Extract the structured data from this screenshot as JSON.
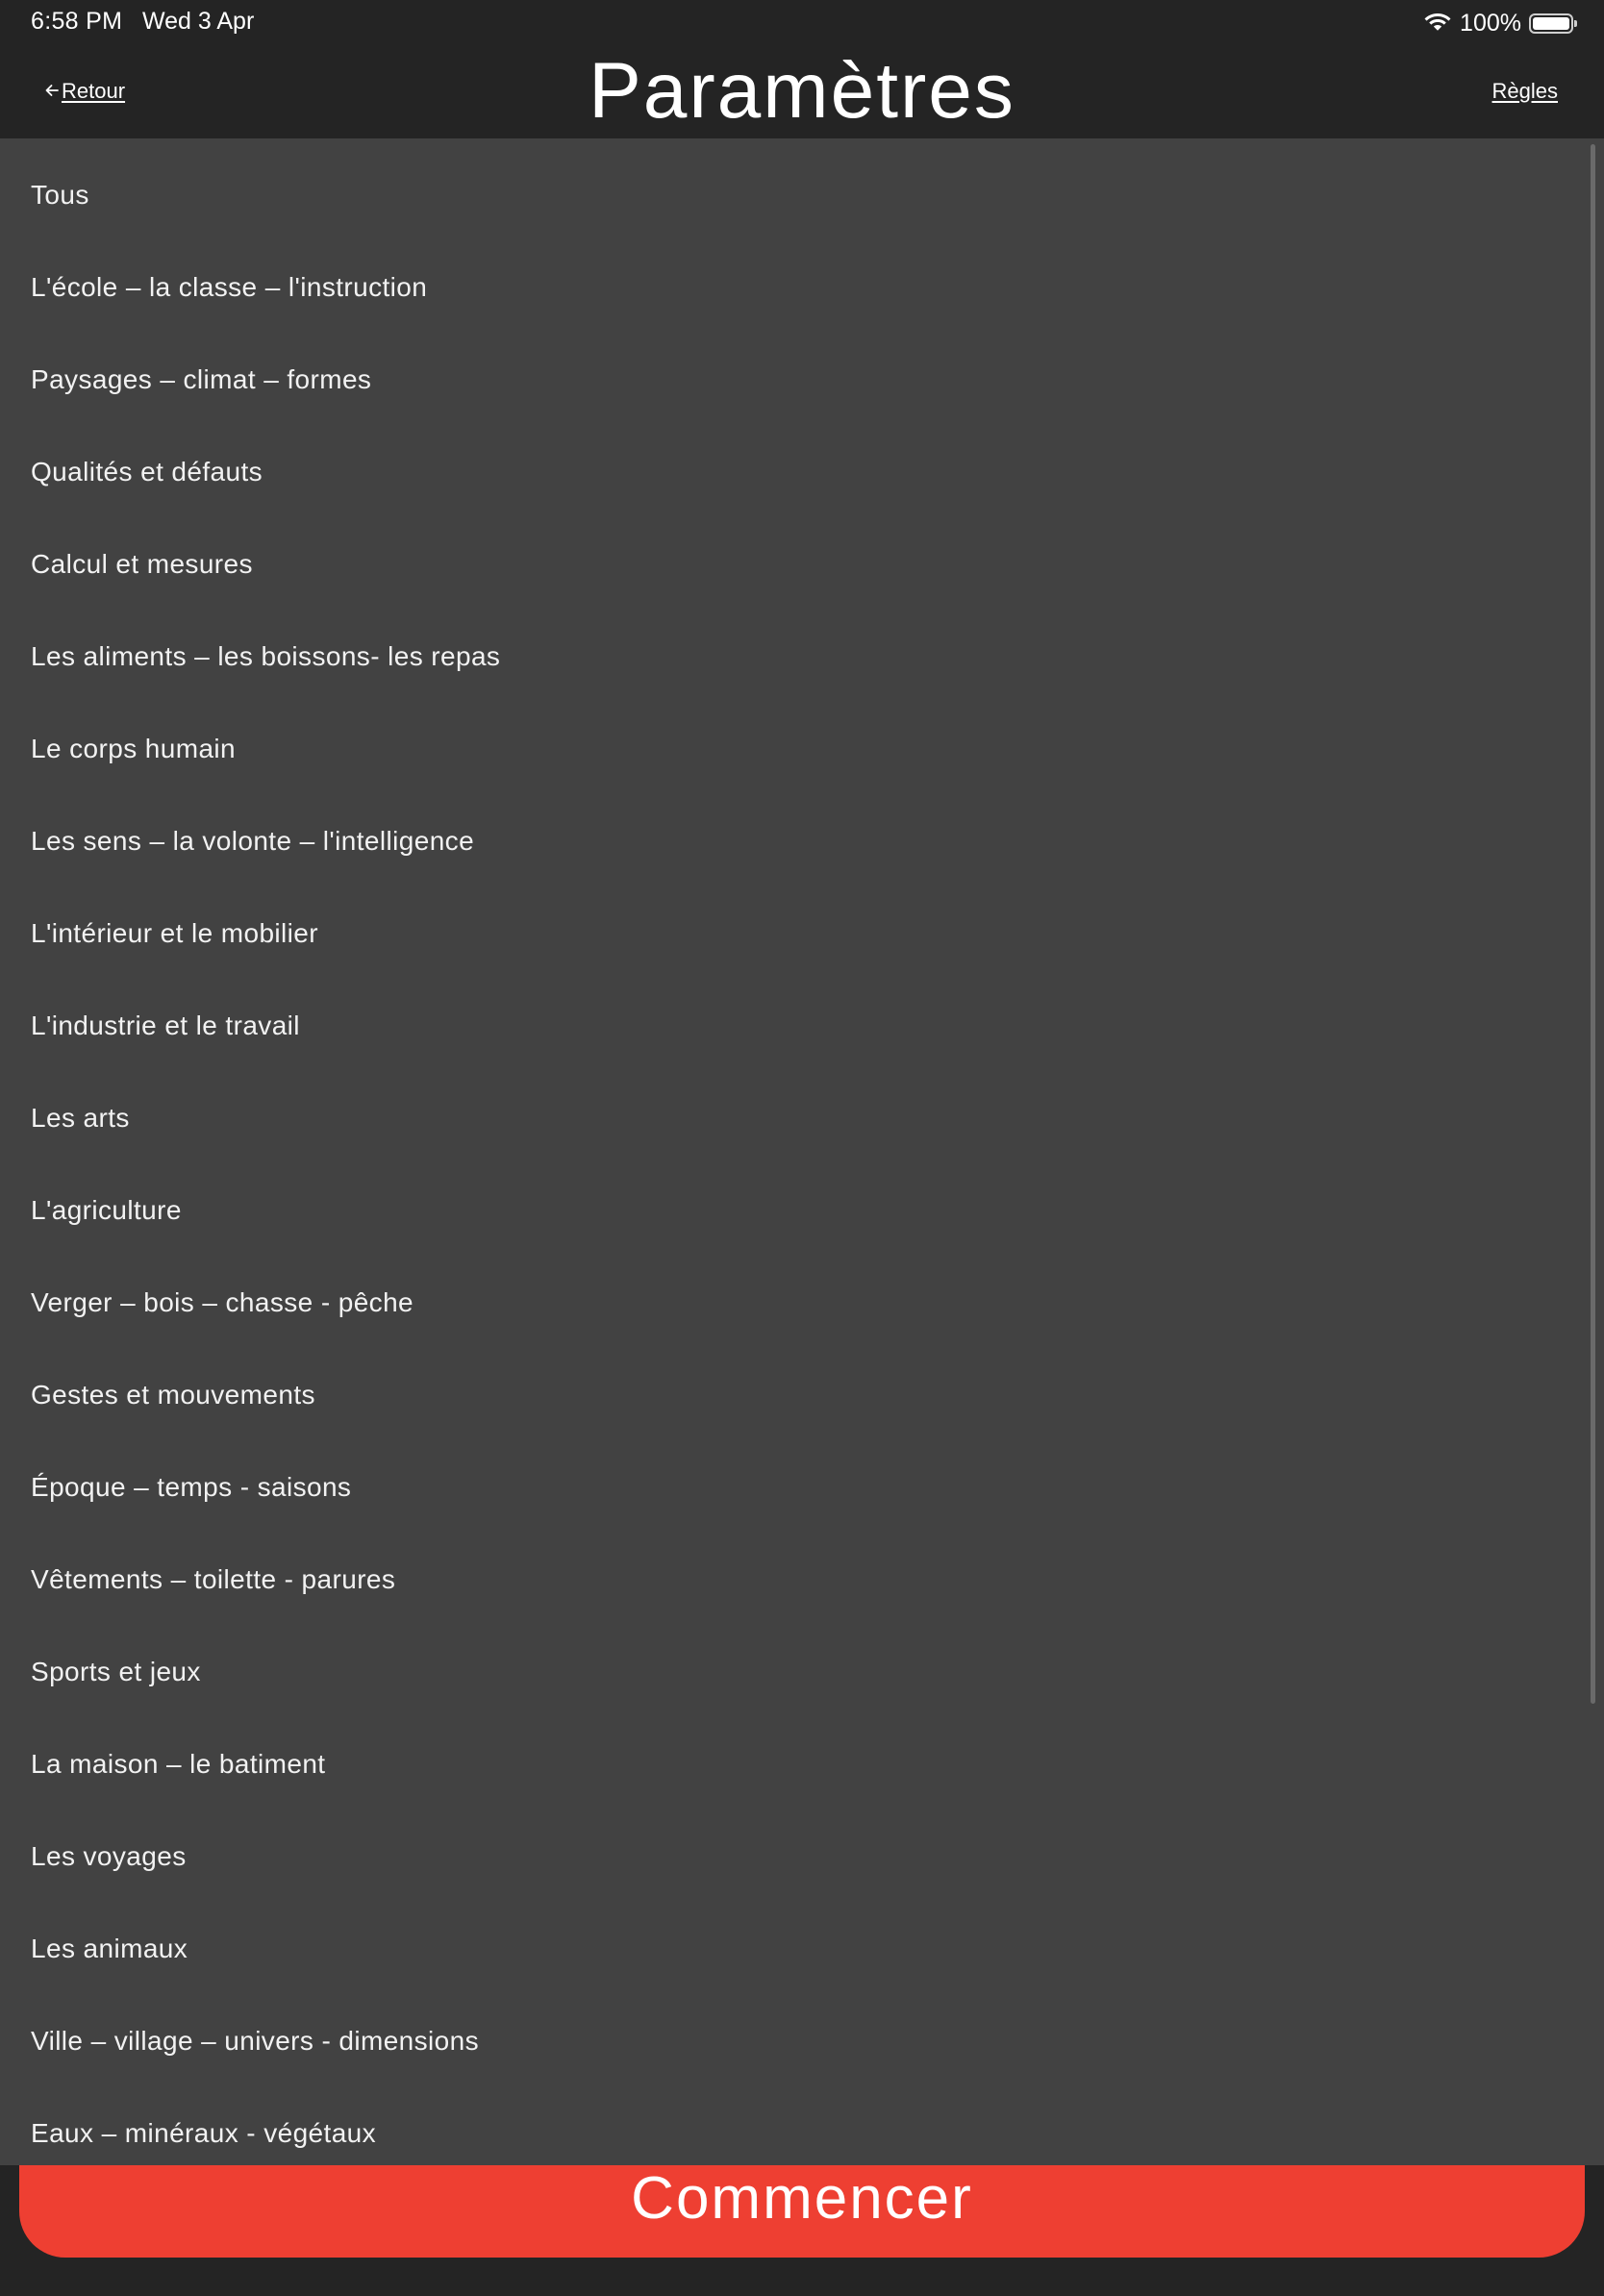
{
  "status_bar": {
    "time": "6:58 PM",
    "date": "Wed 3 Apr",
    "battery_percent": "100%",
    "battery_level": 1.0,
    "wifi_icon": "wifi-icon",
    "battery_icon": "battery-icon"
  },
  "header": {
    "back_label": "Retour",
    "back_icon": "arrow-left-icon",
    "title": "Paramètres",
    "rules_label": "Règles"
  },
  "categories": [
    "Tous",
    "L'école – la classe – l'instruction",
    "Paysages – climat – formes",
    "Qualités et défauts",
    "Calcul et mesures",
    "Les aliments – les boissons- les repas",
    "Le corps humain",
    "Les sens – la volonte – l'intelligence",
    "L'intérieur et le mobilier",
    "L'industrie et le travail",
    "Les arts",
    "L'agriculture",
    "Verger – bois – chasse - pêche",
    "Gestes et mouvements",
    "Époque – temps - saisons",
    "Vêtements – toilette - parures",
    "Sports et jeux",
    "La maison – le batiment",
    "Les voyages",
    "Les animaux",
    "Ville – village – univers - dimensions",
    "Eaux – minéraux - végétaux"
  ],
  "start_button": {
    "label": "Commencer"
  },
  "colors": {
    "background": "#242424",
    "list_background": "#424242",
    "accent": "#ee3f32",
    "text": "#ffffff"
  }
}
